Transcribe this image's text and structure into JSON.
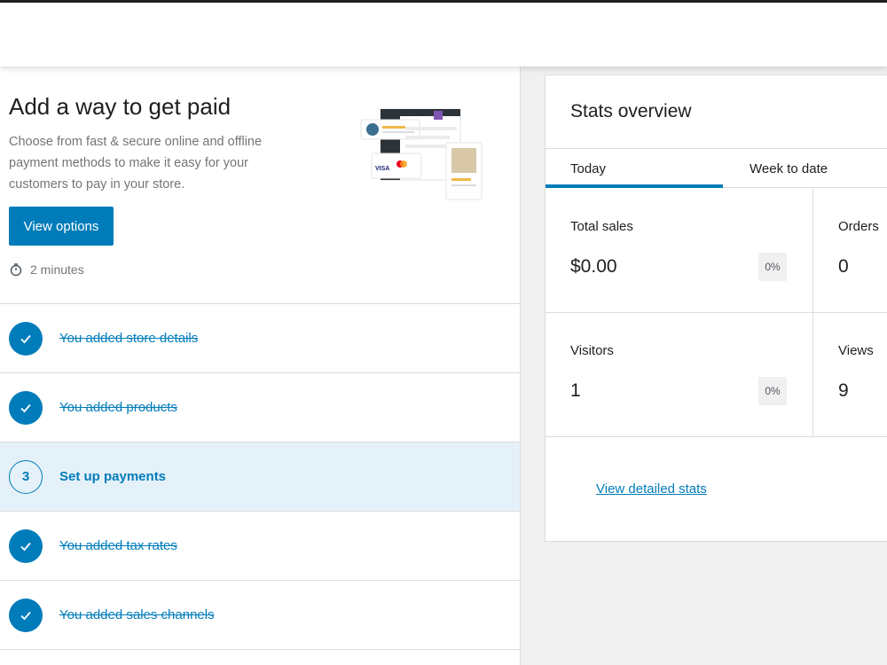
{
  "task_hero": {
    "title": "Add a way to get paid",
    "description": "Choose from fast & secure online and offline payment methods to make it easy for your customers to pay in your store.",
    "button_label": "View options",
    "time_estimate": "2 minutes",
    "illustration_card_text": "VISA"
  },
  "tasks": [
    {
      "label": "You added store details",
      "status": "done"
    },
    {
      "label": "You added products",
      "status": "done"
    },
    {
      "label": "Set up payments",
      "status": "current",
      "number": "3"
    },
    {
      "label": "You added tax rates",
      "status": "done"
    },
    {
      "label": "You added sales channels",
      "status": "done"
    }
  ],
  "stats": {
    "title": "Stats overview",
    "tabs": [
      "Today",
      "Week to date"
    ],
    "active_tab": "Today",
    "cells": [
      {
        "label": "Total sales",
        "value": "$0.00",
        "change": "0%"
      },
      {
        "label": "Orders",
        "value": "0",
        "change": ""
      },
      {
        "label": "Visitors",
        "value": "1",
        "change": "0%"
      },
      {
        "label": "Views",
        "value": "9",
        "change": ""
      }
    ],
    "link_label": "View detailed stats"
  },
  "colors": {
    "accent": "#007cba",
    "active_row_bg": "#e5f1f8",
    "page_bg": "#f0f0f1"
  },
  "icons": {
    "check": "check-icon",
    "timer": "stopwatch-icon"
  }
}
